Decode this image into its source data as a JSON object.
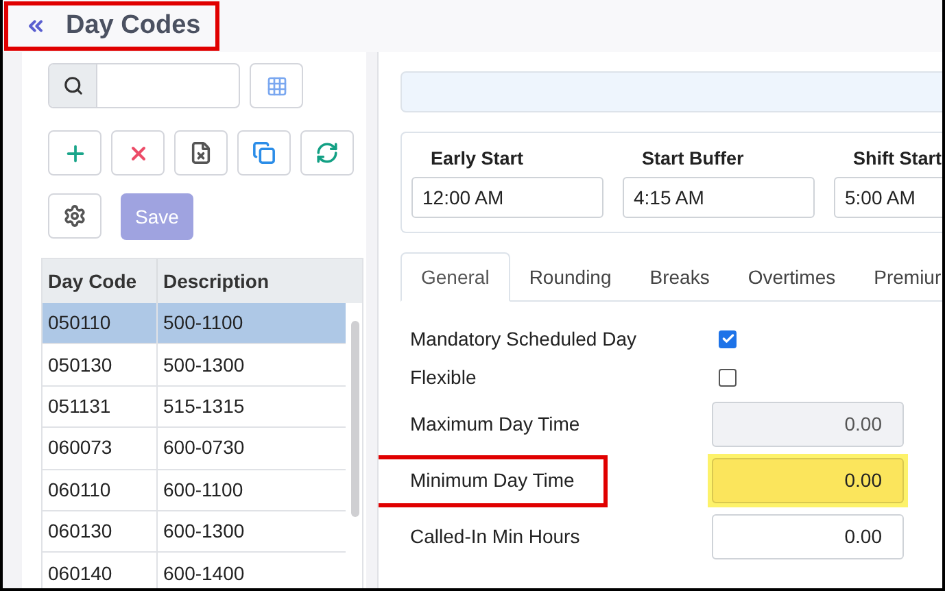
{
  "header": {
    "title": "Day Codes",
    "annotated": true
  },
  "toolbar": {
    "save_label": "Save",
    "save_disabled": true
  },
  "table": {
    "columns": [
      "Day Code",
      "Description"
    ],
    "rows": [
      {
        "cells": [
          "050110",
          "500-1100"
        ],
        "selected": true
      },
      {
        "cells": [
          "050130",
          "500-1300"
        ],
        "selected": false
      },
      {
        "cells": [
          "051131",
          "515-1315"
        ],
        "selected": false
      },
      {
        "cells": [
          "060073",
          "600-0730"
        ],
        "selected": false
      },
      {
        "cells": [
          "060110",
          "600-1100"
        ],
        "selected": false
      },
      {
        "cells": [
          "060130",
          "600-1300"
        ],
        "selected": false
      },
      {
        "cells": [
          "060140",
          "600-1400"
        ],
        "selected": false
      }
    ]
  },
  "times": [
    {
      "label": "Early Start",
      "value": "12:00 AM"
    },
    {
      "label": "Start Buffer",
      "value": "4:15 AM"
    },
    {
      "label": "Shift Start",
      "value": "5:00 AM"
    }
  ],
  "tabs": [
    {
      "label": "General",
      "selected": true
    },
    {
      "label": "Rounding",
      "selected": false
    },
    {
      "label": "Breaks",
      "selected": false
    },
    {
      "label": "Overtimes",
      "selected": false
    },
    {
      "label": "Premiur",
      "selected": false
    }
  ],
  "fields": [
    {
      "kind": "checkbox",
      "label": "Mandatory Scheduled Day",
      "checked": true
    },
    {
      "kind": "checkbox",
      "label": "Flexible",
      "checked": false
    },
    {
      "kind": "number",
      "label": "Maximum Day Time",
      "value": "0.00",
      "disabled": true,
      "highlighted": false,
      "annotated": false
    },
    {
      "kind": "number",
      "label": "Minimum Day Time",
      "value": "0.00",
      "disabled": false,
      "highlighted": true,
      "annotated": true
    },
    {
      "kind": "number",
      "label": "Called-In Min Hours",
      "value": "0.00",
      "disabled": false,
      "highlighted": false,
      "annotated": false
    }
  ]
}
